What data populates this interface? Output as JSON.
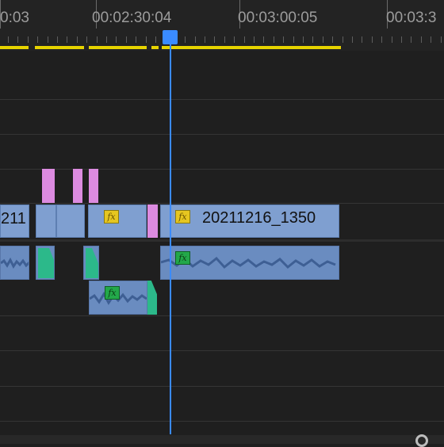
{
  "ruler": {
    "timecodes": [
      "0:03",
      "00:02:30:04",
      "00:03:00:05",
      "00:03:3"
    ]
  },
  "timeline": {
    "clip_name": "20211216_1350",
    "clip_name_partial": "211",
    "effect_badge": "fx",
    "playhead_color": "#3a8bff",
    "work_area_color": "#e8d400",
    "video_clip_color": "#7f9fd0",
    "audio_clip_color": "#6a8cc0",
    "transition_color": "#dc8be0",
    "fade_color": "#2cb98a"
  }
}
